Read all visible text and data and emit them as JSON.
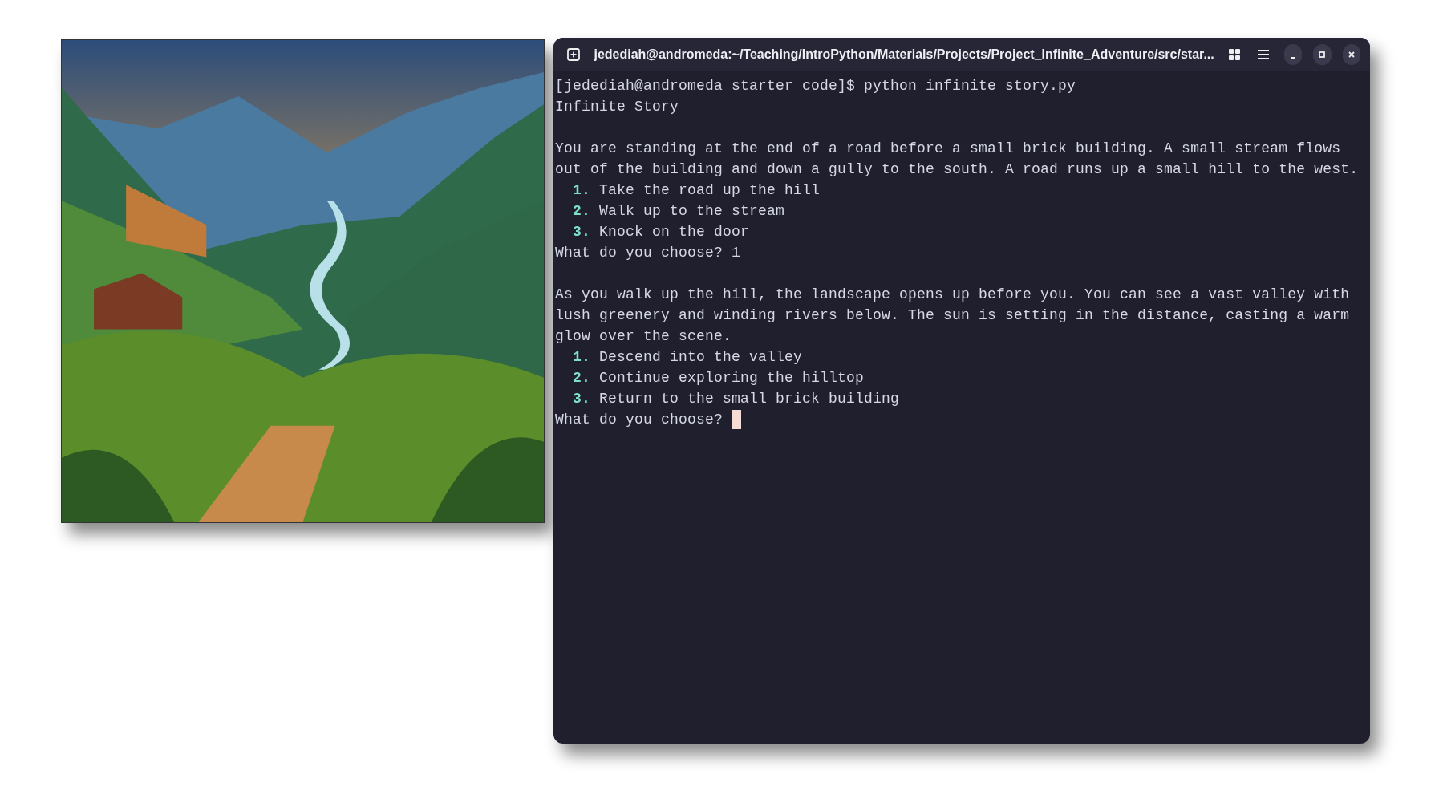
{
  "terminal": {
    "title": "jedediah@andromeda:~/Teaching/IntroPython/Materials/Projects/Project_Infinite_Adventure/src/star...",
    "lines": [
      {
        "kind": "command",
        "prompt": "[jedediah@andromeda starter_code]$",
        "command": "python infinite_story.py"
      },
      {
        "kind": "text",
        "text": "Infinite Story"
      },
      {
        "kind": "blank"
      },
      {
        "kind": "text",
        "text": "You are standing at the end of a road before a small brick building. A small stream flows"
      },
      {
        "kind": "text",
        "text": "out of the building and down a gully to the south. A road runs up a small hill to the west."
      },
      {
        "kind": "option",
        "number": "1.",
        "text": "Take the road up the hill"
      },
      {
        "kind": "option",
        "number": "2.",
        "text": "Walk up to the stream"
      },
      {
        "kind": "option",
        "number": "3.",
        "text": "Knock on the door"
      },
      {
        "kind": "input",
        "prompt": "What do you choose?",
        "value": "1"
      },
      {
        "kind": "blank"
      },
      {
        "kind": "text",
        "text": "As you walk up the hill, the landscape opens up before you. You can see a vast valley with"
      },
      {
        "kind": "text",
        "text": "lush greenery and winding rivers below. The sun is setting in the distance, casting a warm"
      },
      {
        "kind": "text",
        "text": "glow over the scene."
      },
      {
        "kind": "option",
        "number": "1.",
        "text": "Descend into the valley"
      },
      {
        "kind": "option",
        "number": "2.",
        "text": "Continue exploring the hilltop"
      },
      {
        "kind": "option",
        "number": "3.",
        "text": "Return to the small brick building"
      },
      {
        "kind": "input",
        "prompt": "What do you choose?",
        "cursor": true
      }
    ]
  }
}
